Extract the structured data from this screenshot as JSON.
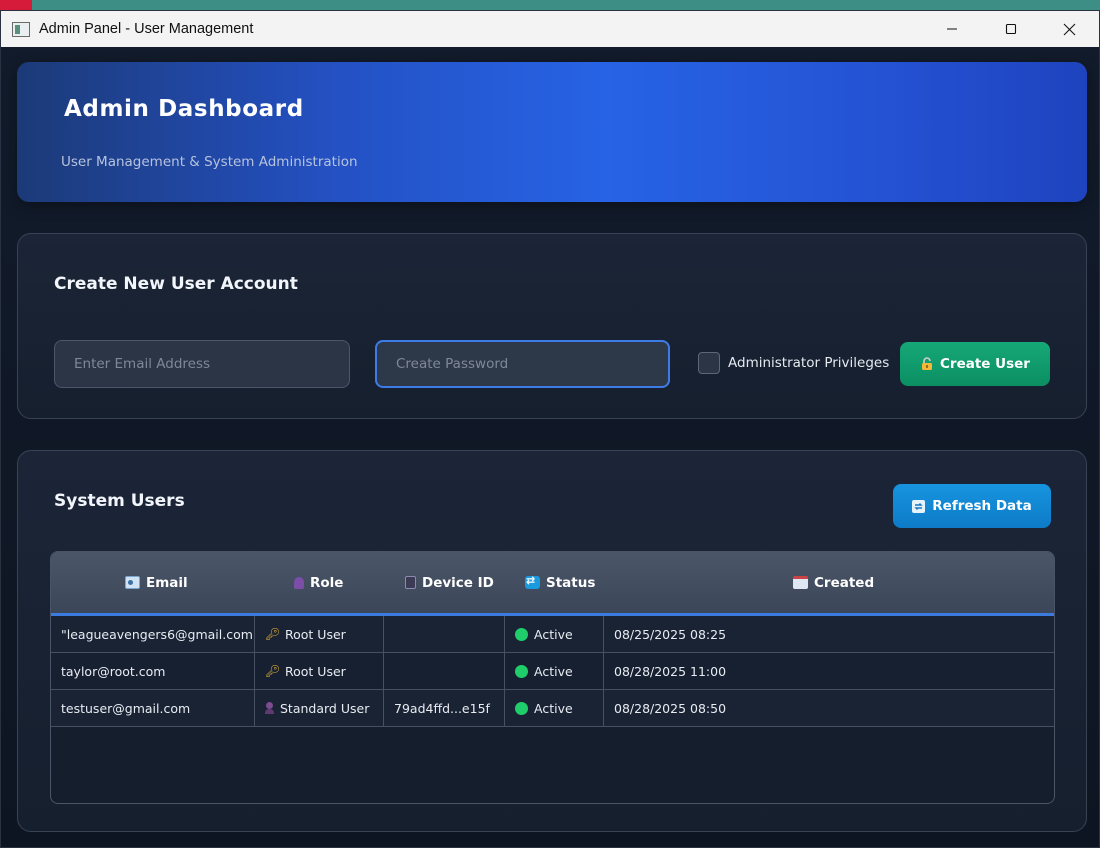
{
  "window": {
    "title": "Admin Panel - User Management"
  },
  "hero": {
    "title": "Admin Dashboard",
    "subtitle": "User Management & System Administration"
  },
  "create_form": {
    "title": "Create New User Account",
    "email_placeholder": "Enter Email Address",
    "email_value": "",
    "password_placeholder": "Create Password",
    "password_value": "",
    "admin_checkbox_label": "Administrator Privileges",
    "admin_checked": false,
    "submit_label": "Create User",
    "submit_icon": "lock-icon"
  },
  "users": {
    "title": "System Users",
    "refresh_label": "Refresh Data",
    "refresh_icon": "refresh-icon",
    "columns": {
      "email": "Email",
      "role": "Role",
      "device": "Device ID",
      "status": "Status",
      "created": "Created"
    },
    "rows": [
      {
        "email": "\"leagueavengers6@gmail.com\"",
        "role": "Root User",
        "role_icon": "key-icon",
        "device": "",
        "status": "Active",
        "created": "08/25/2025 08:25"
      },
      {
        "email": "taylor@root.com",
        "role": "Root User",
        "role_icon": "key-icon",
        "device": "",
        "status": "Active",
        "created": "08/28/2025 11:00"
      },
      {
        "email": "testuser@gmail.com",
        "role": "Standard User",
        "role_icon": "user-icon",
        "device": "79ad4ffd...e15f",
        "status": "Active",
        "created": "08/28/2025 08:50"
      }
    ]
  },
  "colors": {
    "accent_blue": "#2763e5",
    "create_green": "#16a877",
    "refresh_blue": "#1794df",
    "active_green": "#1fce6a"
  }
}
